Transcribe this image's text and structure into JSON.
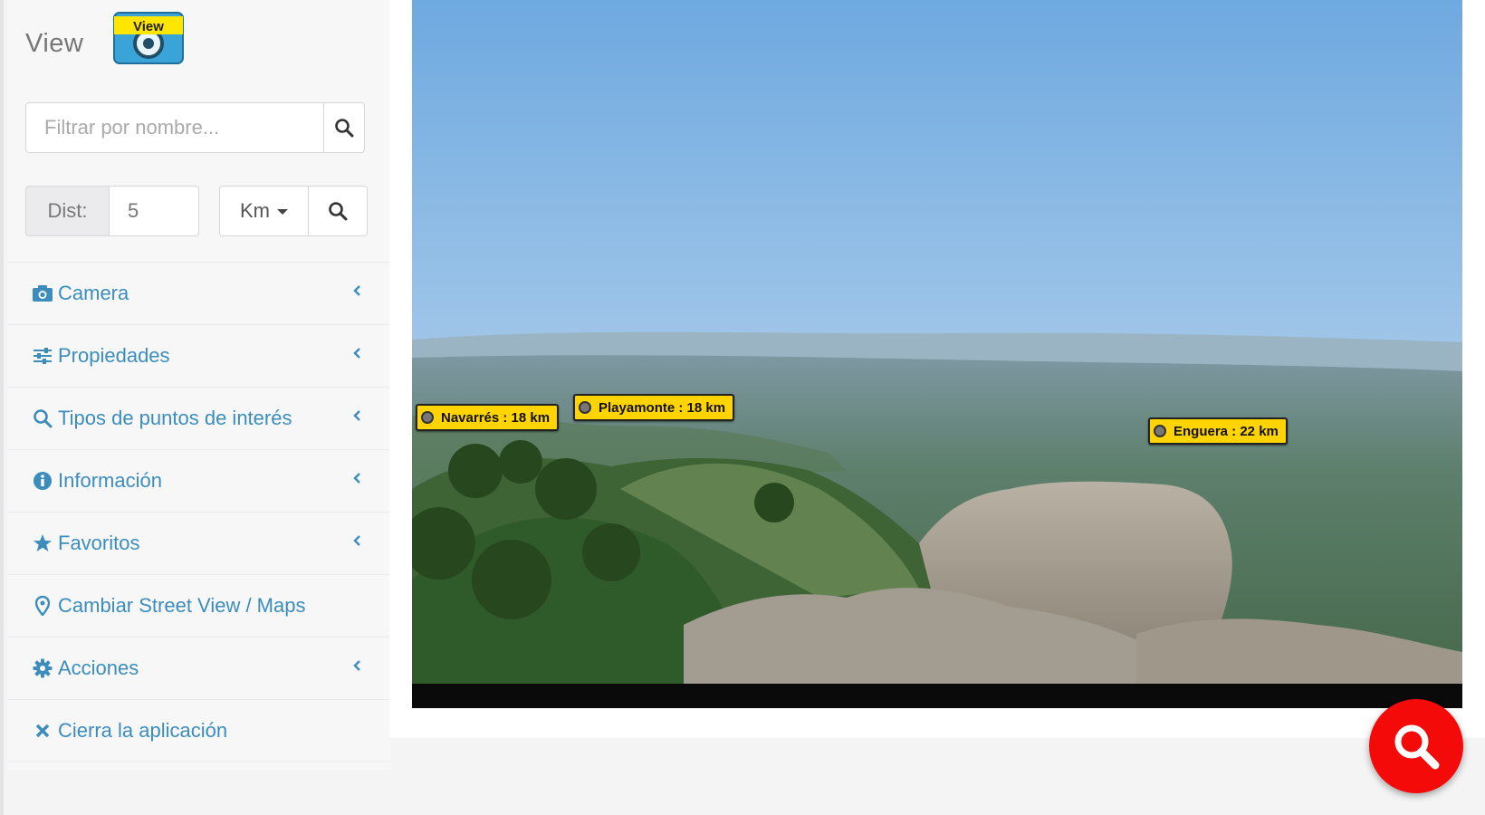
{
  "brand": {
    "title": "View",
    "logo_text": "View"
  },
  "filter": {
    "placeholder": "Filtrar por nombre..."
  },
  "distance": {
    "label": "Dist:",
    "value": "5",
    "unit": "Km"
  },
  "menu": [
    {
      "label": "Camera",
      "icon": "camera-icon",
      "chevron": true
    },
    {
      "label": "Propiedades",
      "icon": "sliders-icon",
      "chevron": true
    },
    {
      "label": "Tipos de puntos de interés",
      "icon": "search-icon",
      "chevron": true
    },
    {
      "label": "Información",
      "icon": "info-icon",
      "chevron": true
    },
    {
      "label": "Favoritos",
      "icon": "star-icon",
      "chevron": true
    },
    {
      "label": "Cambiar Street View / Maps",
      "icon": "map-marker-icon",
      "chevron": false
    },
    {
      "label": "Acciones",
      "icon": "gear-icon",
      "chevron": true
    },
    {
      "label": "Cierra la aplicación",
      "icon": "close-icon",
      "chevron": false
    }
  ],
  "viewer": {
    "pois": [
      {
        "label": "Navarrés : 18 km"
      },
      {
        "label": "Playamonte : 18 km"
      },
      {
        "label": "Enguera : 22 km"
      }
    ]
  },
  "colors": {
    "accent": "#3c8dbc",
    "poi": "#ffd400",
    "fab": "#f50a0a",
    "logo": "#3aa3d8"
  }
}
